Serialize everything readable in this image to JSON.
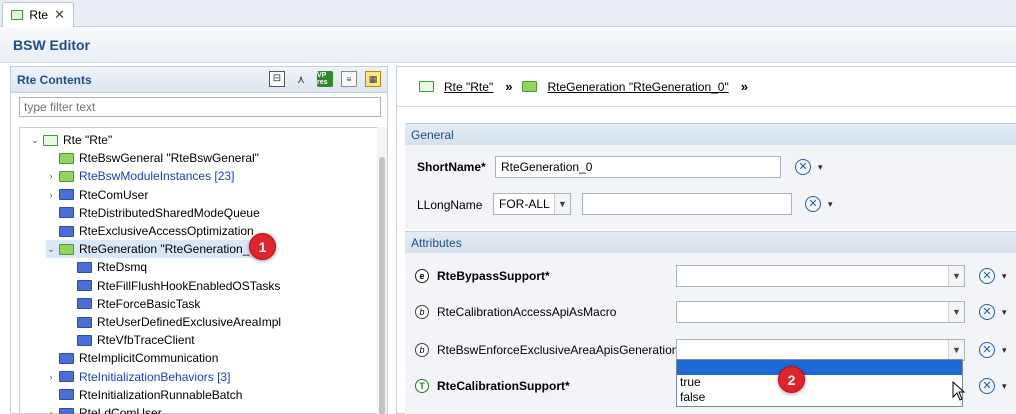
{
  "tab": {
    "label": "Rte",
    "close_glyph": "✕"
  },
  "editor": {
    "title": "BSW Editor"
  },
  "left_panel": {
    "title": "Rte Contents",
    "filter_placeholder": "type filter text",
    "tools": [
      {
        "name": "collapse-all-icon",
        "glyph": "⊟"
      },
      {
        "name": "link-editor-icon",
        "glyph": "⋏"
      },
      {
        "name": "vp-res-icon",
        "glyph": "VP res"
      },
      {
        "name": "document-icon",
        "glyph": "≡"
      },
      {
        "name": "table-layout-icon",
        "glyph": "▦"
      }
    ],
    "tree": [
      {
        "label": "Rte \"Rte\"",
        "indent": 0,
        "chevron": "⌄",
        "icon": "pkg",
        "link": false
      },
      {
        "label": "RteBswGeneral \"RteBswGeneral\"",
        "indent": 1,
        "chevron": "",
        "icon": "green",
        "link": false
      },
      {
        "label": "RteBswModuleInstances [23]",
        "indent": 1,
        "chevron": "›",
        "icon": "green",
        "link": true
      },
      {
        "label": "RteComUser",
        "indent": 1,
        "chevron": "›",
        "icon": "blue",
        "link": false
      },
      {
        "label": "RteDistributedSharedModeQueue",
        "indent": 1,
        "chevron": "",
        "icon": "blue",
        "link": false
      },
      {
        "label": "RteExclusiveAccessOptimization",
        "indent": 1,
        "chevron": "",
        "icon": "blue",
        "link": false
      },
      {
        "label": "RteGeneration \"RteGeneration_0\"",
        "indent": 1,
        "chevron": "⌄",
        "icon": "green",
        "link": false,
        "selected": true
      },
      {
        "label": "RteDsmq",
        "indent": 2,
        "chevron": "",
        "icon": "blue",
        "link": false
      },
      {
        "label": "RteFillFlushHookEnabledOSTasks",
        "indent": 2,
        "chevron": "",
        "icon": "blue",
        "link": false
      },
      {
        "label": "RteForceBasicTask",
        "indent": 2,
        "chevron": "",
        "icon": "blue",
        "link": false
      },
      {
        "label": "RteUserDefinedExclusiveAreaImpl",
        "indent": 2,
        "chevron": "",
        "icon": "blue",
        "link": false
      },
      {
        "label": "RteVfbTraceClient",
        "indent": 2,
        "chevron": "",
        "icon": "blue",
        "link": false
      },
      {
        "label": "RteImplicitCommunication",
        "indent": 1,
        "chevron": "",
        "icon": "blue",
        "link": false
      },
      {
        "label": "RteInitializationBehaviors [3]",
        "indent": 1,
        "chevron": "›",
        "icon": "blue",
        "link": true
      },
      {
        "label": "RteInitializationRunnableBatch",
        "indent": 1,
        "chevron": "",
        "icon": "blue",
        "link": false
      },
      {
        "label": "RteLdComUser",
        "indent": 1,
        "chevron": "›",
        "icon": "blue",
        "link": false
      }
    ]
  },
  "breadcrumb": {
    "items": [
      "Rte \"Rte\"",
      "RteGeneration \"RteGeneration_0\""
    ],
    "separator": "»",
    "trailing": "»"
  },
  "general": {
    "header": "General",
    "shortname_label": "ShortName*",
    "shortname_value": "RteGeneration_0",
    "longname_label": "LLongName",
    "longname_lang": "FOR-ALL",
    "longname_value": ""
  },
  "attributes": {
    "header": "Attributes",
    "rows": [
      {
        "label": "RteBypassSupport*",
        "type_glyph": "e",
        "bold": true,
        "value": ""
      },
      {
        "label": "RteCalibrationAccessApiAsMacro",
        "type_glyph": "b",
        "bold": false,
        "value": ""
      },
      {
        "label": "RteBswEnforceExclusiveAreaApisGeneration",
        "type_glyph": "b",
        "bold": false,
        "value": ""
      },
      {
        "label": "RteCalibrationSupport*",
        "type_glyph": "T",
        "bold": true,
        "value": ""
      }
    ],
    "dropdown_options": [
      "",
      "true",
      "false"
    ]
  },
  "badges": [
    "1",
    "2"
  ],
  "glyphs": {
    "combo_arrow": "▼",
    "x_button": "✕",
    "menu_arrow": "▾"
  }
}
